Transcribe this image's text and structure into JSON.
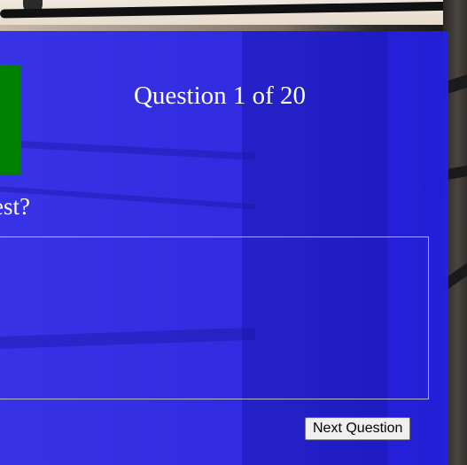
{
  "quiz": {
    "question_counter": "Question 1 of 20",
    "question_text": "est?",
    "next_button_label": "Next Question"
  },
  "colors": {
    "panel": "#2420F0",
    "timer_block": "#008000",
    "text": "#FFFFFF"
  }
}
